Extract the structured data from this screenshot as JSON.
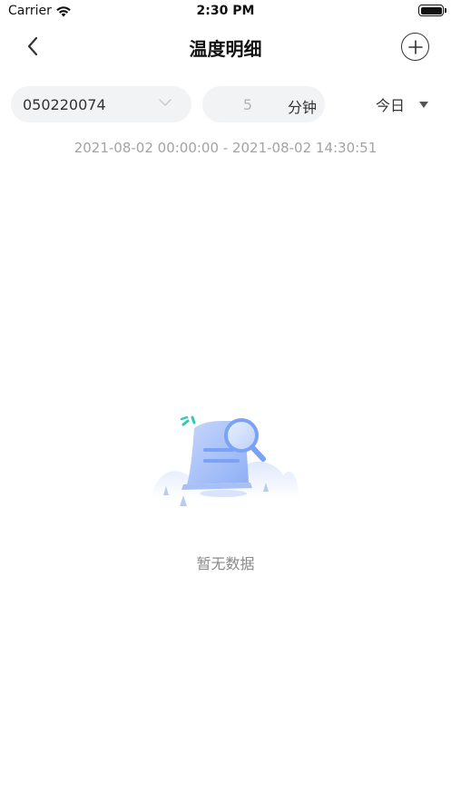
{
  "status_bar": {
    "carrier": "Carrier",
    "time": "2:30 PM",
    "icons": [
      "wifi-icon",
      "battery-icon"
    ]
  },
  "nav": {
    "title": "温度明细",
    "icons": [
      "back-chevron-icon",
      "plus-circle-icon"
    ]
  },
  "filters": {
    "device_id": "050220074",
    "interval_placeholder": "5",
    "interval_unit": "分钟",
    "range_label": "今日",
    "icons": [
      "chevron-down-icon",
      "triangle-down-icon"
    ]
  },
  "time_range": "2021-08-02 00:00:00 - 2021-08-02 14:30:51",
  "empty_state": {
    "message": "暂无数据",
    "illustration": "document-magnifier-illustration"
  },
  "colors": {
    "accent_blue": "#7ba2f5",
    "accent_teal": "#33c9b4",
    "muted_text": "#a3a3a3"
  }
}
